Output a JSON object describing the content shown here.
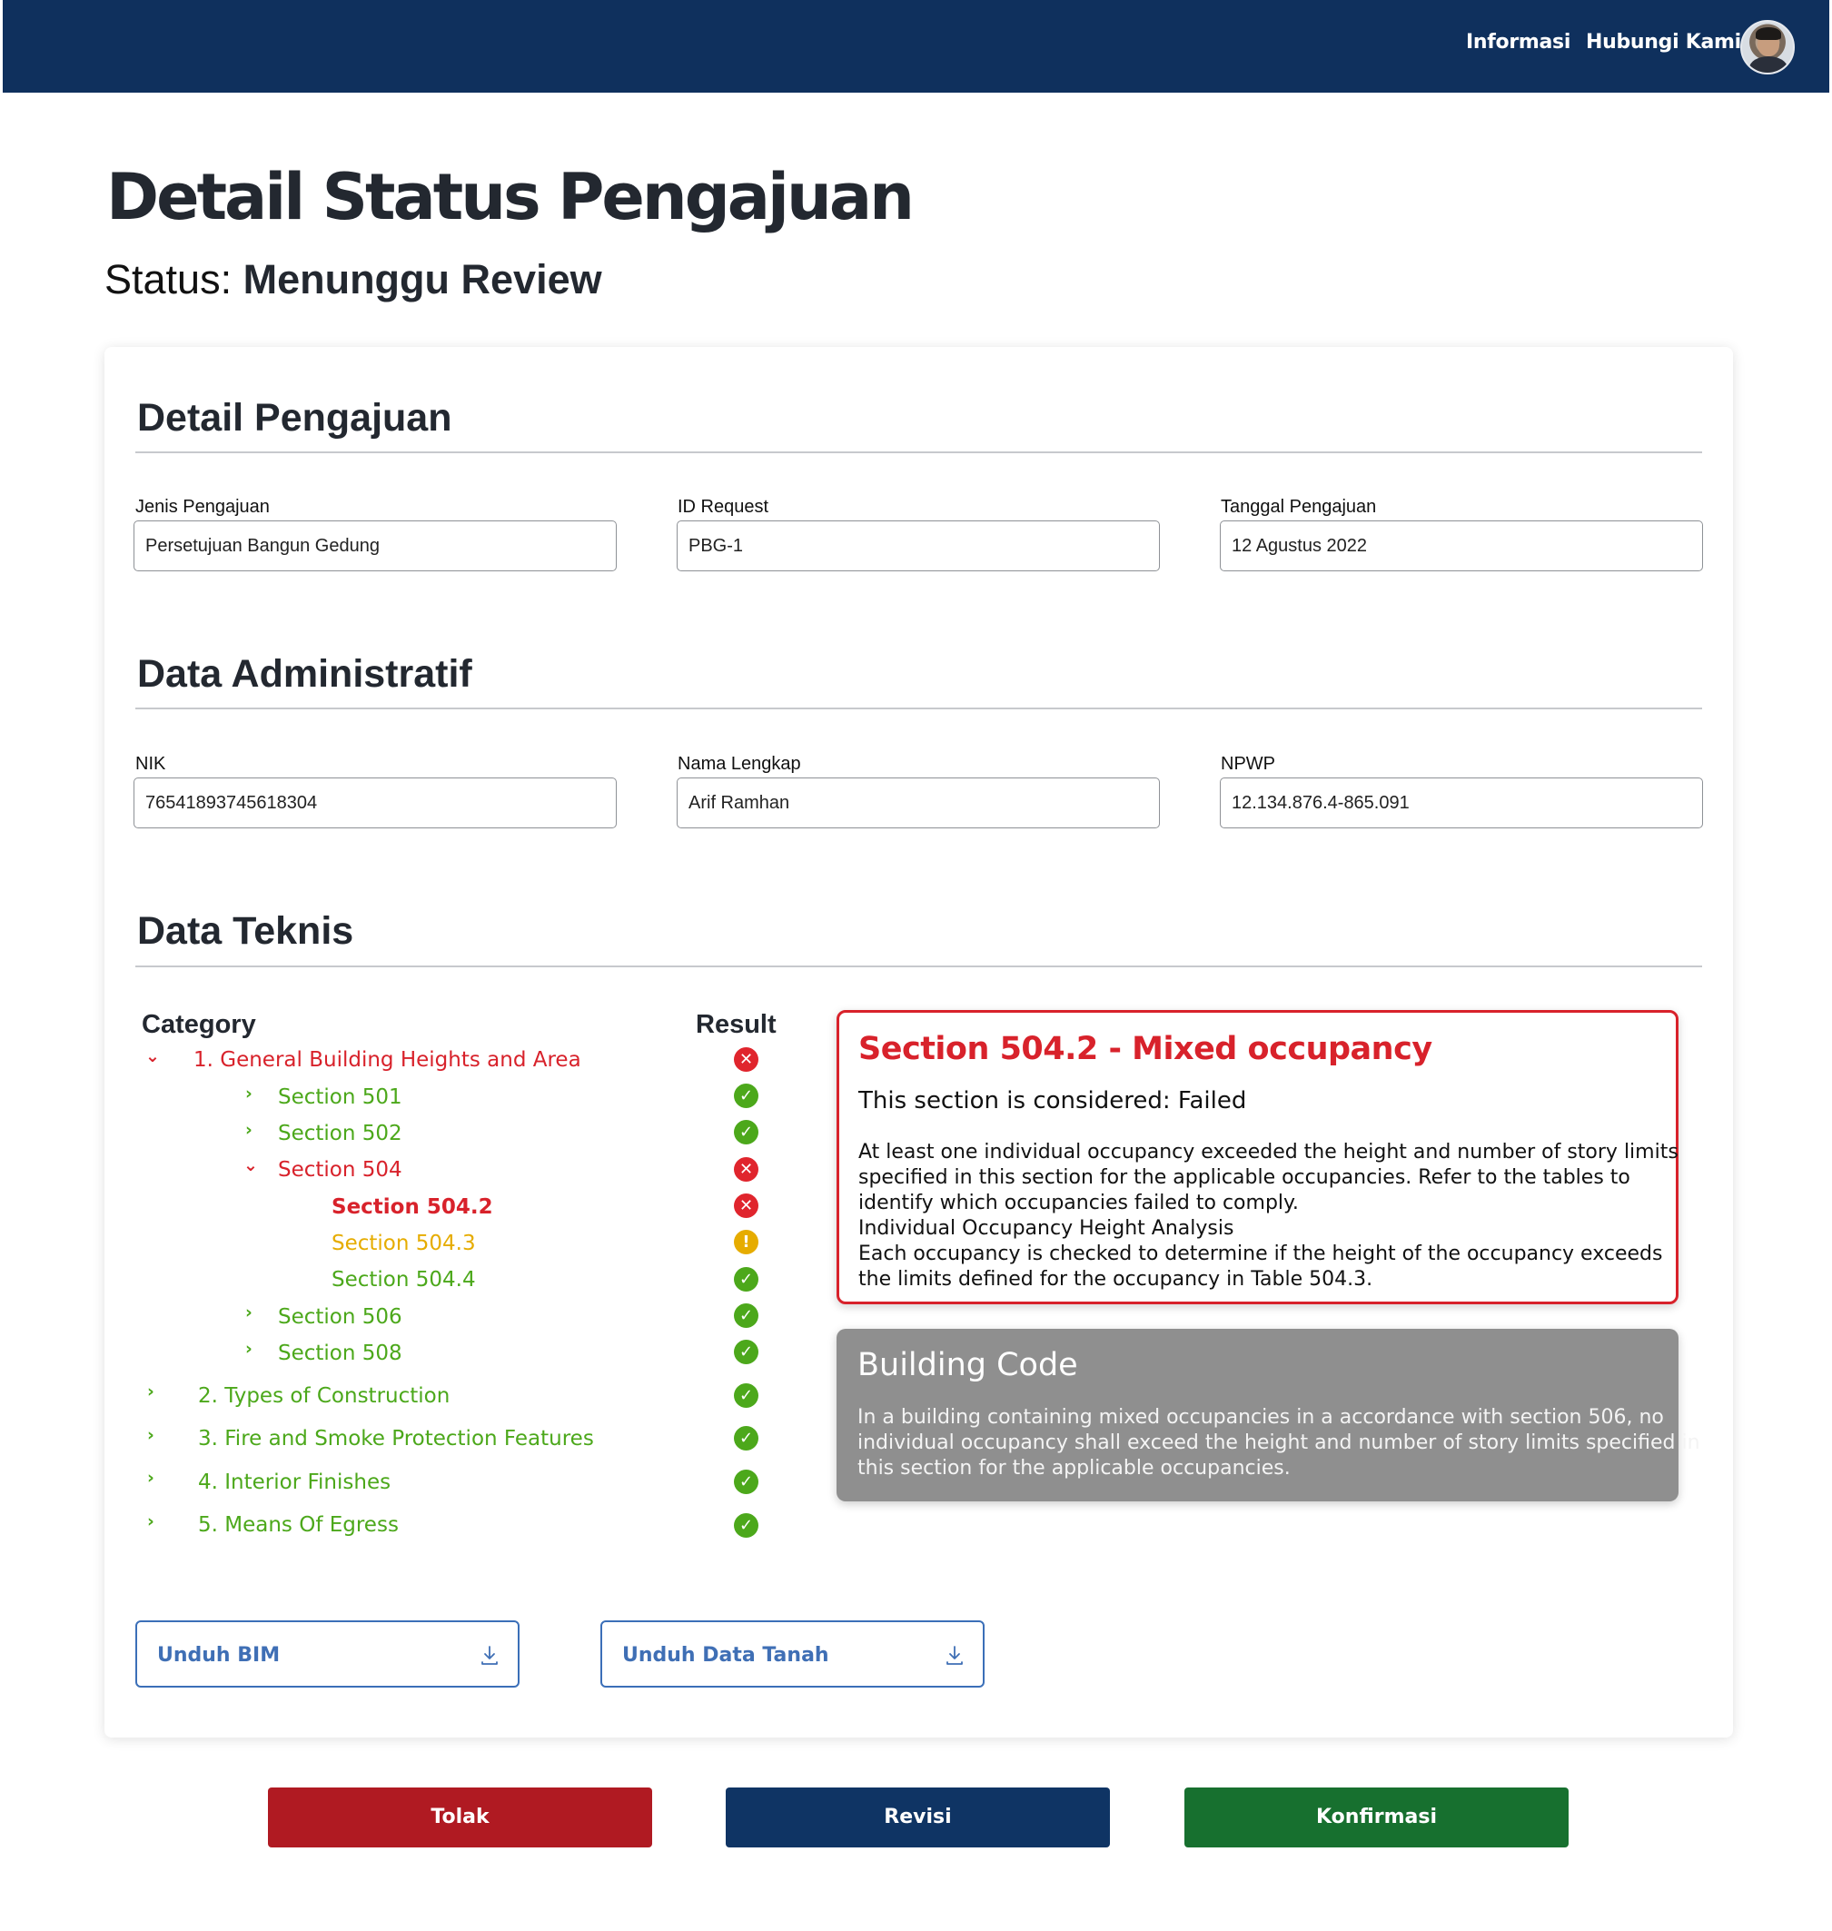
{
  "header": {
    "nav": [
      "Informasi",
      "Hubungi Kami"
    ]
  },
  "page": {
    "title": "Detail Status Pengajuan",
    "status_prefix": "Status: ",
    "status_value": "Menunggu Review"
  },
  "detail_pengajuan": {
    "title": "Detail Pengajuan",
    "fields": [
      {
        "label": "Jenis Pengajuan",
        "value": "Persetujuan Bangun Gedung"
      },
      {
        "label": "ID Request",
        "value": "PBG-1"
      },
      {
        "label": "Tanggal Pengajuan",
        "value": "12 Agustus 2022"
      }
    ]
  },
  "data_administratif": {
    "title": "Data Administratif",
    "fields": [
      {
        "label": "NIK",
        "value": "76541893745618304"
      },
      {
        "label": "Nama Lengkap",
        "value": "Arif Ramhan"
      },
      {
        "label": "NPWP",
        "value": "12.134.876.4-865.091"
      }
    ]
  },
  "data_teknis": {
    "title": "Data Teknis",
    "col_category": "Category",
    "col_result": "Result",
    "items": [
      {
        "label": "1. General Building Heights and Area",
        "result": "fail",
        "expanded": true
      },
      {
        "label": "Section 501",
        "result": "pass",
        "expanded": false
      },
      {
        "label": "Section 502",
        "result": "pass",
        "expanded": false
      },
      {
        "label": "Section 504",
        "result": "fail",
        "expanded": true
      },
      {
        "label": "Section 504.2",
        "result": "fail",
        "selected": true
      },
      {
        "label": "Section 504.3",
        "result": "warning"
      },
      {
        "label": "Section 504.4",
        "result": "pass"
      },
      {
        "label": "Section 506",
        "result": "pass",
        "expanded": false
      },
      {
        "label": "Section 508",
        "result": "pass",
        "expanded": false
      },
      {
        "label": "2. Types of Construction",
        "result": "pass",
        "expanded": false
      },
      {
        "label": "3. Fire and Smoke Protection Features",
        "result": "pass",
        "expanded": false
      },
      {
        "label": "4. Interior Finishes",
        "result": "pass",
        "expanded": false
      },
      {
        "label": "5. Means Of Egress",
        "result": "pass",
        "expanded": false
      }
    ],
    "detail": {
      "title": "Section 504.2 - Mixed occupancy",
      "status": "This section is considered: Failed",
      "lines": [
        "At least one individual occupancy exceeded the height and number of story limits",
        "specified in this section for the applicable occupancies. Refer to the tables to",
        "identify which occupancies failed to comply.",
        "Individual Occupancy Height Analysis",
        "Each occupancy is checked to determine if the height of the occupancy exceeds",
        "the limits defined for the occupancy in Table 504.3."
      ]
    },
    "building_code": {
      "title": "Building Code",
      "lines": [
        "In a building containing mixed occupancies in a accordance with section 506, no",
        "individual occupancy shall exceed the height and number of story limits specified in",
        "this section for the applicable occupancies."
      ]
    }
  },
  "downloads": [
    "Unduh BIM",
    "Unduh Data Tanah"
  ],
  "actions": {
    "reject": "Tolak",
    "revise": "Revisi",
    "confirm": "Konfirmasi"
  },
  "colors": {
    "navbar": "#0f305d",
    "fail": "#d8222b",
    "pass": "#4ca81b",
    "warning": "#e6ac00",
    "reject_button": "#b01a22",
    "revise_button": "#0f3464",
    "confirm_button": "#17702f",
    "download_border": "#3b6fb8"
  }
}
